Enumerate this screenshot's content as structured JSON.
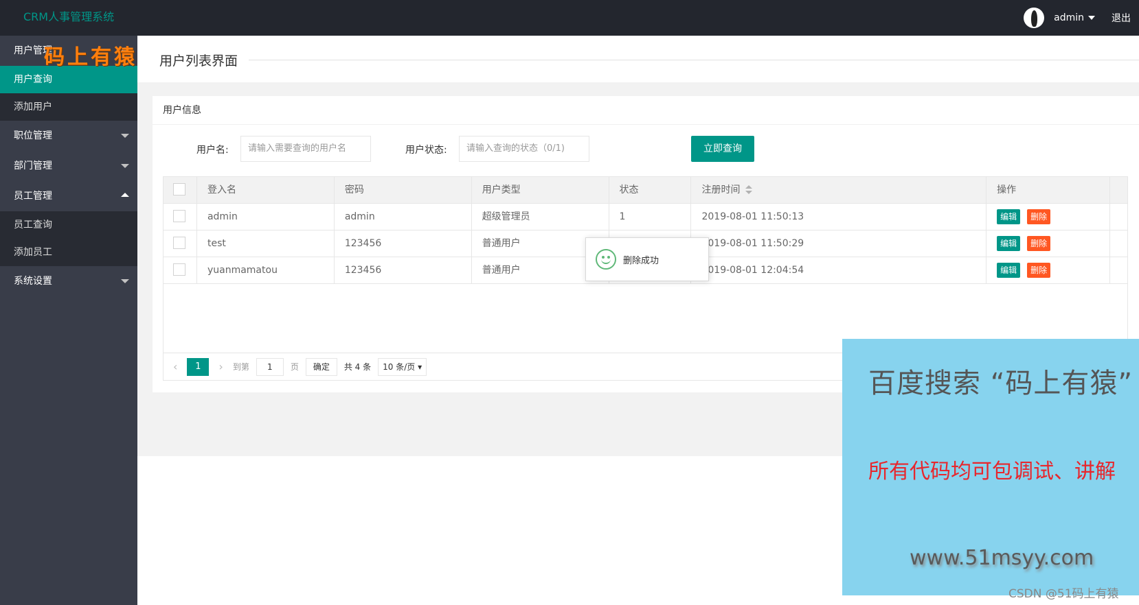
{
  "app": {
    "title": "CRM人事管理系统"
  },
  "header": {
    "username": "admin",
    "logout_label": "退出"
  },
  "sidebar": {
    "groups": [
      {
        "label": "用户管理",
        "expanded": true,
        "children": [
          "用户查询",
          "添加用户"
        ],
        "active_child": "用户查询"
      },
      {
        "label": "职位管理",
        "expanded": false
      },
      {
        "label": "部门管理",
        "expanded": false
      },
      {
        "label": "员工管理",
        "expanded": true,
        "children": [
          "员工查询",
          "添加员工"
        ]
      },
      {
        "label": "系统设置",
        "expanded": false
      }
    ]
  },
  "watermark": {
    "left_text": "码上有猿"
  },
  "page": {
    "title": "用户列表界面"
  },
  "card": {
    "header": "用户信息"
  },
  "search": {
    "username_label": "用户名:",
    "username_placeholder": "请输入需要查询的用户名",
    "status_label": "用户状态:",
    "status_placeholder": "请输入查询的状态（0/1)",
    "submit_label": "立即查询"
  },
  "table": {
    "columns": [
      "登入名",
      "密码",
      "用户类型",
      "状态",
      "注册时间",
      "操作"
    ],
    "rows": [
      {
        "login": "admin",
        "password": "admin",
        "type": "超级管理员",
        "status": "1",
        "registered": "2019-08-01 11:50:13"
      },
      {
        "login": "test",
        "password": "123456",
        "type": "普通用户",
        "status": "",
        "registered": "2019-08-01 11:50:29"
      },
      {
        "login": "yuanmamatou",
        "password": "123456",
        "type": "普通用户",
        "status": "",
        "registered": "2019-08-01 12:04:54"
      }
    ],
    "edit_label": "编辑",
    "delete_label": "删除"
  },
  "pagination": {
    "current_page": "1",
    "goto_prefix": "到第",
    "goto_value": "1",
    "goto_suffix": "页",
    "confirm_label": "确定",
    "total_label": "共 4 条",
    "page_size_label": "10 条/页"
  },
  "toast": {
    "message": "删除成功"
  },
  "ad": {
    "title": "百度搜索 “码上有猿”",
    "subtitle": "所有代码均可包调试、讲解",
    "url": "www.51msyy.com"
  },
  "credit": "CSDN @51码上有猿",
  "colors": {
    "primary": "#009688",
    "danger": "#ff5722",
    "header_bg": "#23262e",
    "sidebar_bg": "#393d49"
  }
}
